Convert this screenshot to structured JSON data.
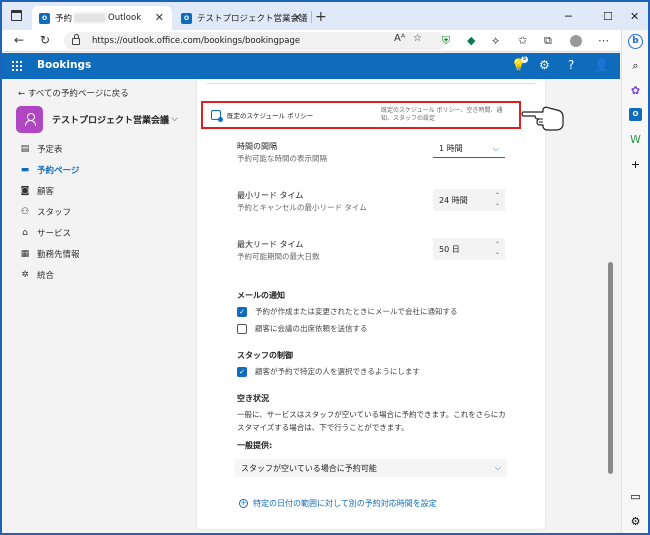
{
  "browser": {
    "tabs": [
      {
        "label_prefix": "予約",
        "label_suffix": "Outlook",
        "icon": "O"
      },
      {
        "label": "テストプロジェクト営業会議",
        "icon": "O"
      }
    ],
    "url": "https://outlook.office.com/bookings/bookingpage",
    "sidebar_icons": [
      "bing-icon",
      "search-icon",
      "copilot-icon",
      "outlook-icon",
      "bookings-icon",
      "add-icon",
      "sidebar-toggle-icon",
      "settings-icon"
    ]
  },
  "header": {
    "app_title": "Bookings",
    "badge_count": "5"
  },
  "leftnav": {
    "back_label": "すべての予約ページに戻る",
    "page_name": "テストプロジェクト営業会議",
    "items": [
      {
        "label": "予定表",
        "icon": "calendar-icon",
        "active": false
      },
      {
        "label": "予約ページ",
        "icon": "booking-page-icon",
        "active": true
      },
      {
        "label": "顧客",
        "icon": "customer-icon",
        "active": false
      },
      {
        "label": "スタッフ",
        "icon": "staff-icon",
        "active": false
      },
      {
        "label": "サービス",
        "icon": "service-icon",
        "active": false
      },
      {
        "label": "勤務先情報",
        "icon": "business-info-icon",
        "active": false
      },
      {
        "label": "統合",
        "icon": "integration-icon",
        "active": false
      }
    ]
  },
  "policy": {
    "title": "既定のスケジュール ポリシー",
    "description": "既定のスケジュール ポリシー、空き時間、通知、スタッフの設定"
  },
  "scheduling": {
    "interval_label": "時間の間隔",
    "interval_sub": "予約可能な時間の表示間隔",
    "interval_value": "1 時間",
    "min_lead_label": "最小リード タイム",
    "min_lead_sub": "予約とキャンセルの最小リード タイム",
    "min_lead_value": "24 時間",
    "max_lead_label": "最大リード タイム",
    "max_lead_sub": "予約可能期間の最大日数",
    "max_lead_value": "50 日"
  },
  "email": {
    "heading": "メールの通知",
    "options": [
      {
        "label": "予約が作成または変更されたときにメールで会社に通知する",
        "checked": true
      },
      {
        "label": "顧客に会議の出席依頼を送信する",
        "checked": false
      }
    ]
  },
  "staff": {
    "heading": "スタッフの制御",
    "options": [
      {
        "label": "顧客が予約で特定の人を選択できるようにします",
        "checked": true
      }
    ]
  },
  "availability": {
    "heading": "空き状況",
    "description": "一般に、サービスはスタッフが空いている場合に予約できます。これをさらにカスタマイズする場合は、下で行うことができます。",
    "general_label": "一般提供:",
    "general_value": "スタッフが空いている場合に予約可能",
    "add_range_label": "特定の日付の範囲に対して別の予約対応時間を設定"
  }
}
